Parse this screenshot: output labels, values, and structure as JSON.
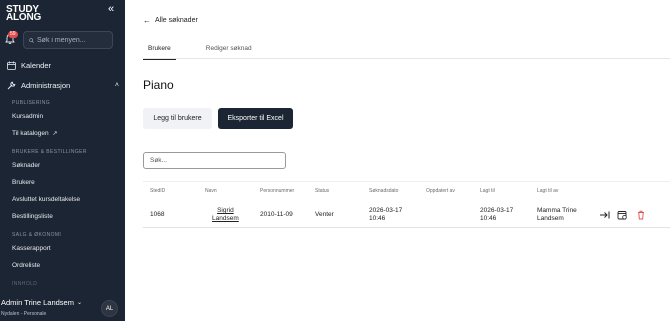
{
  "app": {
    "logo_line1": "STUDY",
    "logo_line2": "ALONG"
  },
  "sidebar": {
    "notifications_count": "59",
    "search_placeholder": "Søk i menyen...",
    "calendar_label": "Kalender",
    "admin_label": "Administrasjon",
    "sections": [
      {
        "title": "PUBLISERING",
        "items": [
          "Kursadmin",
          "Til katalogen"
        ]
      },
      {
        "title": "BRUKERE & BESTILLINGER",
        "items": [
          "Søknader",
          "Brukere",
          "Avsluttet kursdeltakelse",
          "Bestillingsliste"
        ]
      },
      {
        "title": "SALG & ØKONOMI",
        "items": [
          "Kasserapport",
          "Ordreliste"
        ]
      },
      {
        "title": "INNHOLD",
        "items": []
      }
    ],
    "user": {
      "name": "Admin Trine Landsem",
      "org": "Nydalen - Personale",
      "initials": "AL"
    }
  },
  "main": {
    "back_label": "Alle søknader",
    "tabs": [
      {
        "label": "Brukere",
        "active": true
      },
      {
        "label": "Rediger søknad",
        "active": false
      }
    ],
    "title": "Piano",
    "add_button": "Legg til brukere",
    "export_button": "Eksporter til Excel",
    "filter_placeholder": "Søk...",
    "table": {
      "headers": [
        "StedID",
        "Navn",
        "Personnummer",
        "Status",
        "Søknadsdato",
        "Oppdatert av",
        "Lagt til",
        "Lagt til av"
      ],
      "rows": [
        {
          "stedid": "1068",
          "navn_line1": "Sigrid",
          "navn_line2": "Landsem",
          "personnummer": "2010-11-09",
          "status": "Venter",
          "soknadsdato_date": "2026-03-17",
          "soknadsdato_time": "10:46",
          "oppdatert_av": "",
          "lagt_til_date": "2026-03-17",
          "lagt_til_time": "10:46",
          "lagt_til_av_line1": "Mamma Trine",
          "lagt_til_av_line2": "Landsem"
        }
      ]
    }
  },
  "colors": {
    "sidebar_bg": "#1c2533",
    "badge": "#e64b4b",
    "delete": "#d9534f"
  }
}
